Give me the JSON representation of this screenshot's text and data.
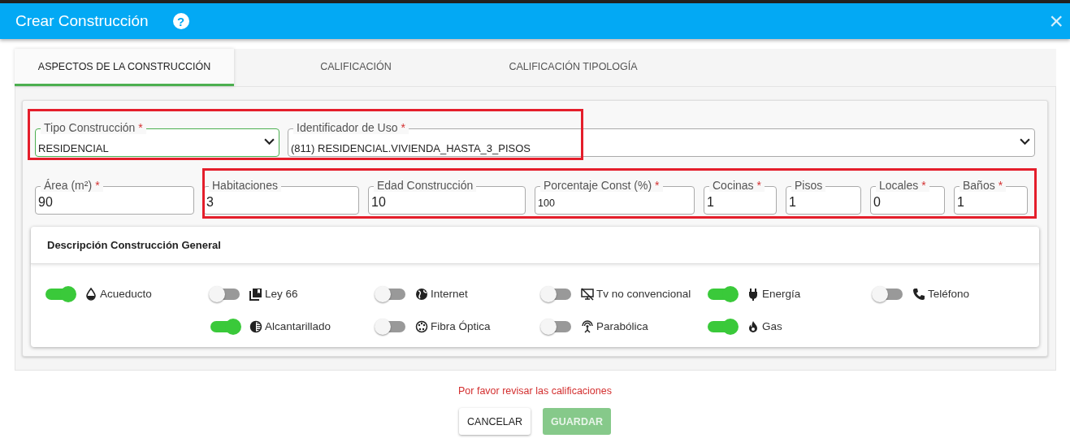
{
  "window": {
    "title": "Crear Construcción",
    "help_icon": "?",
    "close": "×"
  },
  "tabs": [
    {
      "label": "ASPECTOS DE LA CONSTRUCCIÓN",
      "selected": true
    },
    {
      "label": "CALIFICACIÓN",
      "selected": false
    },
    {
      "label": "CALIFICACIÓN TIPOLOGÍA",
      "selected": false
    }
  ],
  "row_1": [
    {
      "label": "Tipo Construcción",
      "required_mark": "*",
      "value": "RESIDENCIAL",
      "kind": "select",
      "focused": true
    },
    {
      "label": "Identificador de Uso",
      "required_mark": "*",
      "value": "(811) RESIDENCIAL.VIVIENDA_HASTA_3_PISOS",
      "kind": "select",
      "focused": false
    }
  ],
  "row_2": [
    {
      "label": "Área (m²)",
      "required_mark": "*",
      "value": "90"
    },
    {
      "label": "Habitaciones",
      "value": "3"
    },
    {
      "label": "Edad Construcción",
      "value": "10"
    },
    {
      "label": "Porcentaje Const (%)",
      "required_mark": "*",
      "value": "100"
    },
    {
      "label": "Cocinas",
      "required_mark": "*",
      "value": "1"
    },
    {
      "label": "Pisos",
      "value": "1"
    },
    {
      "label": "Locales",
      "required_mark": "*",
      "value": "0"
    },
    {
      "label": "Baños",
      "required_mark": "*",
      "value": "1"
    }
  ],
  "annotations": [
    {
      "kind": "highlight"
    },
    {
      "kind": "highlight"
    }
  ],
  "services": {
    "title": "Descripción Construcción General",
    "columns": [
      [
        {
          "label": "Acueducto",
          "on": true
        }
      ],
      [
        {
          "label": "Ley 66",
          "on": false
        },
        {
          "label": "Alcantarillado",
          "on": true
        }
      ],
      [
        {
          "label": "Internet",
          "on": false
        },
        {
          "label": "Fibra Óptica",
          "on": false
        }
      ],
      [
        {
          "label": "Tv no convencional",
          "on": false
        },
        {
          "label": "Parabólica",
          "on": false
        }
      ],
      [
        {
          "label": "Energía",
          "on": true
        },
        {
          "label": "Gas",
          "on": true
        }
      ],
      [
        {
          "label": "Teléfono",
          "on": false
        }
      ]
    ]
  },
  "message": "Por favor revisar las calificaciones",
  "buttons": [
    {
      "label": "CANCELAR",
      "disabled": false
    },
    {
      "label": "GUARDAR",
      "disabled": true
    }
  ]
}
